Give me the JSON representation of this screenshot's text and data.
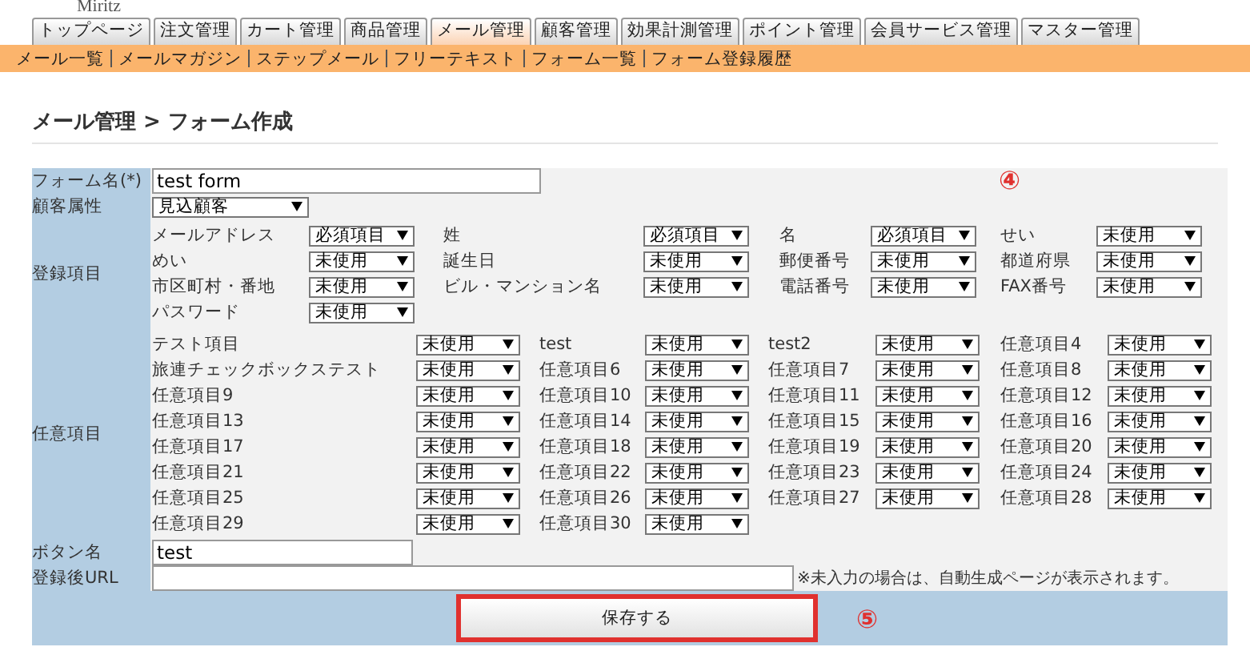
{
  "logo": "Miritz",
  "main_tabs": [
    {
      "label": "トップページ",
      "selected": false
    },
    {
      "label": "注文管理",
      "selected": false
    },
    {
      "label": "カート管理",
      "selected": false
    },
    {
      "label": "商品管理",
      "selected": false
    },
    {
      "label": "メール管理",
      "selected": true
    },
    {
      "label": "顧客管理",
      "selected": false
    },
    {
      "label": "効果計測管理",
      "selected": false
    },
    {
      "label": "ポイント管理",
      "selected": false
    },
    {
      "label": "会員サービス管理",
      "selected": false
    },
    {
      "label": "マスター管理",
      "selected": false
    }
  ],
  "sub_menu": [
    "メール一覧",
    "メールマガジン",
    "ステップメール",
    "フリーテキスト",
    "フォーム一覧",
    "フォーム登録履歴"
  ],
  "page_title": "メール管理 > フォーム作成",
  "form": {
    "form_name": {
      "label": "フォーム名(*)",
      "value": "test form",
      "marker": "④"
    },
    "customer_attribute": {
      "label": "顧客属性",
      "value": "見込顧客"
    },
    "registration_items": {
      "label": "登録項目",
      "items": [
        {
          "name": "メールアドレス",
          "value": "必須項目"
        },
        {
          "name": "姓",
          "value": "必須項目"
        },
        {
          "name": "名",
          "value": "必須項目"
        },
        {
          "name": "せい",
          "value": "未使用"
        },
        {
          "name": "めい",
          "value": "未使用"
        },
        {
          "name": "誕生日",
          "value": "未使用"
        },
        {
          "name": "郵便番号",
          "value": "未使用"
        },
        {
          "name": "都道府県",
          "value": "未使用"
        },
        {
          "name": "市区町村・番地",
          "value": "未使用"
        },
        {
          "name": "ビル・マンション名",
          "value": "未使用"
        },
        {
          "name": "電話番号",
          "value": "未使用"
        },
        {
          "name": "FAX番号",
          "value": "未使用"
        },
        {
          "name": "パスワード",
          "value": "未使用"
        }
      ]
    },
    "optional_items": {
      "label": "任意項目",
      "items": [
        {
          "name": "テスト項目",
          "value": "未使用"
        },
        {
          "name": "test",
          "value": "未使用"
        },
        {
          "name": "test2",
          "value": "未使用"
        },
        {
          "name": "任意項目4",
          "value": "未使用"
        },
        {
          "name": "旅連チェックボックステスト",
          "value": "未使用"
        },
        {
          "name": "任意項目6",
          "value": "未使用"
        },
        {
          "name": "任意項目7",
          "value": "未使用"
        },
        {
          "name": "任意項目8",
          "value": "未使用"
        },
        {
          "name": "任意項目9",
          "value": "未使用"
        },
        {
          "name": "任意項目10",
          "value": "未使用"
        },
        {
          "name": "任意項目11",
          "value": "未使用"
        },
        {
          "name": "任意項目12",
          "value": "未使用"
        },
        {
          "name": "任意項目13",
          "value": "未使用"
        },
        {
          "name": "任意項目14",
          "value": "未使用"
        },
        {
          "name": "任意項目15",
          "value": "未使用"
        },
        {
          "name": "任意項目16",
          "value": "未使用"
        },
        {
          "name": "任意項目17",
          "value": "未使用"
        },
        {
          "name": "任意項目18",
          "value": "未使用"
        },
        {
          "name": "任意項目19",
          "value": "未使用"
        },
        {
          "name": "任意項目20",
          "value": "未使用"
        },
        {
          "name": "任意項目21",
          "value": "未使用"
        },
        {
          "name": "任意項目22",
          "value": "未使用"
        },
        {
          "name": "任意項目23",
          "value": "未使用"
        },
        {
          "name": "任意項目24",
          "value": "未使用"
        },
        {
          "name": "任意項目25",
          "value": "未使用"
        },
        {
          "name": "任意項目26",
          "value": "未使用"
        },
        {
          "name": "任意項目27",
          "value": "未使用"
        },
        {
          "name": "任意項目28",
          "value": "未使用"
        },
        {
          "name": "任意項目29",
          "value": "未使用"
        },
        {
          "name": "任意項目30",
          "value": "未使用"
        }
      ]
    },
    "button_name": {
      "label": "ボタン名",
      "value": "test"
    },
    "redirect_url": {
      "label": "登録後URL",
      "note": "※未入力の場合は、自動生成ページが表示されます。"
    },
    "save_button": {
      "label": "保存する",
      "marker": "⑤"
    }
  }
}
